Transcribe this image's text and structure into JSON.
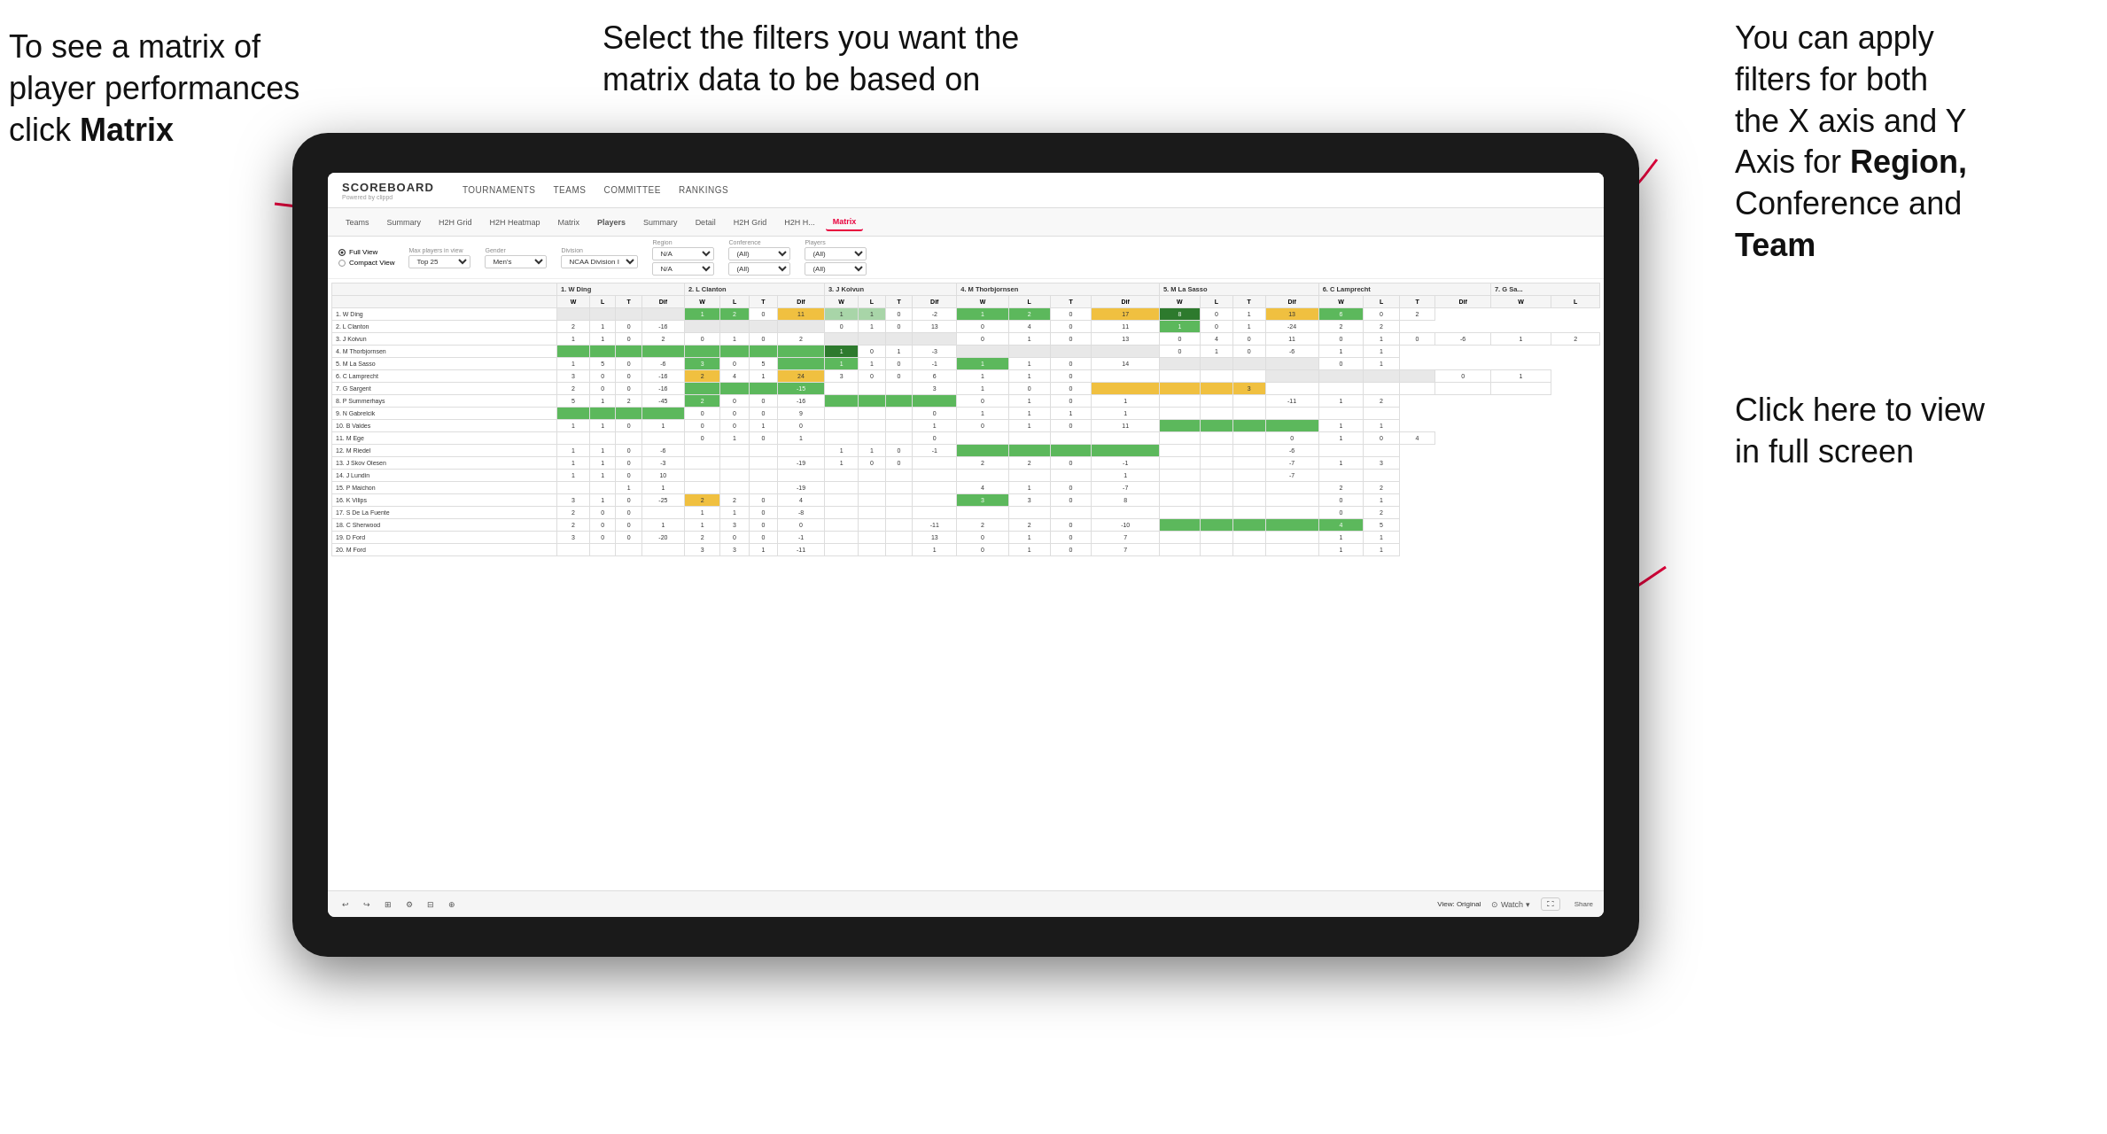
{
  "annotations": {
    "top_left": {
      "line1": "To see a matrix of",
      "line2": "player performances",
      "line3": "click ",
      "bold": "Matrix"
    },
    "top_center": {
      "text": "Select the filters you want the matrix data to be based on"
    },
    "top_right": {
      "line1": "You  can apply",
      "line2": "filters for both",
      "line3": "the X axis and Y",
      "line4": "Axis for ",
      "bold1": "Region,",
      "line5": "Conference and",
      "bold2": "Team"
    },
    "bottom_right": {
      "line1": "Click here to view",
      "line2": "in full screen"
    }
  },
  "navbar": {
    "logo": "SCOREBOARD",
    "powered_by": "Powered by clippd",
    "nav_items": [
      "TOURNAMENTS",
      "TEAMS",
      "COMMITTEE",
      "RANKINGS"
    ]
  },
  "subnav": {
    "tabs": [
      "Teams",
      "Summary",
      "H2H Grid",
      "H2H Heatmap",
      "Matrix",
      "Players",
      "Summary",
      "Detail",
      "H2H Grid",
      "H2H H...",
      "Matrix"
    ]
  },
  "filters": {
    "view_options": [
      "Full View",
      "Compact View"
    ],
    "max_players": {
      "label": "Max players in view",
      "value": "Top 25"
    },
    "gender": {
      "label": "Gender",
      "value": "Men's"
    },
    "division": {
      "label": "Division",
      "value": "NCAA Division I"
    },
    "region": {
      "label": "Region",
      "values": [
        "N/A",
        "N/A"
      ]
    },
    "conference": {
      "label": "Conference",
      "values": [
        "(All)",
        "(All)"
      ]
    },
    "players": {
      "label": "Players",
      "values": [
        "(All)",
        "(All)"
      ]
    }
  },
  "matrix_headers": {
    "columns": [
      "1. W Ding",
      "2. L Clanton",
      "3. J Koivun",
      "4. M Thorbjornsen",
      "5. M La Sasso",
      "6. C Lamprecht",
      "7. G Sa..."
    ],
    "sub_headers": [
      "W",
      "L",
      "T",
      "Dif"
    ]
  },
  "players": [
    "1. W Ding",
    "2. L Clanton",
    "3. J Koivun",
    "4. M Thorbjornsen",
    "5. M La Sasso",
    "6. C Lamprecht",
    "7. G Sargent",
    "8. P Summerhays",
    "9. N Gabrelcik",
    "10. B Valdes",
    "11. M Ege",
    "12. M Riedel",
    "13. J Skov Olesen",
    "14. J Lundin",
    "15. P Maichon",
    "16. K Vilips",
    "17. S De La Fuente",
    "18. C Sherwood",
    "19. D Ford",
    "20. M Ford"
  ],
  "toolbar": {
    "view_label": "View: Original",
    "watch_label": "Watch",
    "share_label": "Share"
  },
  "colors": {
    "accent": "#e8003d",
    "green_dark": "#2d7a2d",
    "green": "#5cb85c",
    "yellow": "#f0c040",
    "orange": "#e08030",
    "white": "#ffffff"
  }
}
